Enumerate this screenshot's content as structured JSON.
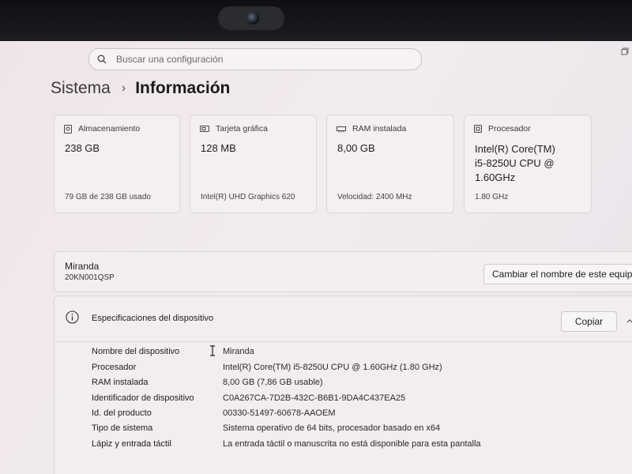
{
  "search": {
    "placeholder": "Buscar una configuración"
  },
  "breadcrumb": {
    "parent": "Sistema",
    "current": "Información"
  },
  "cards": [
    {
      "icon": "storage-icon",
      "title": "Almacenamiento",
      "value": "238 GB",
      "sub": "79 GB de 238 GB usado"
    },
    {
      "icon": "graphics-card-icon",
      "title": "Tarjeta gráfica",
      "value": "128 MB",
      "sub": "Intel(R) UHD Graphics 620"
    },
    {
      "icon": "ram-icon",
      "title": "RAM instalada",
      "value": "8,00 GB",
      "sub": "Velocidad: 2400 MHz"
    },
    {
      "icon": "processor-icon",
      "title": "Procesador",
      "value_lines": [
        "Intel(R) Core(TM)",
        "i5-8250U CPU @",
        "1.60GHz"
      ],
      "sub": "1.80 GHz"
    }
  ],
  "device": {
    "name": "Miranda",
    "model": "20KN001QSP",
    "rename_label": "Cambiar el nombre de este equipo"
  },
  "specs": {
    "title": "Especificaciones del dispositivo",
    "copy_label": "Copiar",
    "rows": [
      {
        "label": "Nombre del dispositivo",
        "value": "Miranda"
      },
      {
        "label": "Procesador",
        "value": "Intel(R) Core(TM) i5-8250U CPU @ 1.60GHz (1.80 GHz)"
      },
      {
        "label": "RAM instalada",
        "value": "8,00 GB (7,86 GB usable)"
      },
      {
        "label": "Identificador de dispositivo",
        "value": "C0A267CA-7D2B-432C-B6B1-9DA4C437EA25"
      },
      {
        "label": "Id. del producto",
        "value": "00330-51497-60678-AAOEM"
      },
      {
        "label": "Tipo de sistema",
        "value": "Sistema operativo de 64 bits, procesador basado en x64"
      },
      {
        "label": "Lápiz y entrada táctil",
        "value": "La entrada táctil o manuscrita no está disponible para esta pantalla"
      }
    ]
  },
  "colors": {
    "accent": "#0067c0",
    "background": "#efe8ea",
    "card": "#f4eff1",
    "border": "#ddd5d8"
  }
}
